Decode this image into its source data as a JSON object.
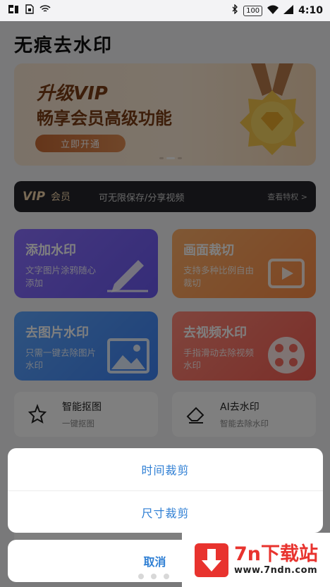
{
  "status_bar": {
    "time": "4:10",
    "battery": "100",
    "icons": [
      "baidu-paw-icon",
      "sim-icon",
      "wifi-icon",
      "bluetooth-icon",
      "battery-icon",
      "wifi-icon",
      "signal-icon"
    ]
  },
  "app": {
    "title": "无痕去水印"
  },
  "banner": {
    "line1": "升级VIP",
    "line2": "畅享会员高级功能",
    "button": "立即开通",
    "slide_count": 3,
    "active_slide": 1
  },
  "vip_bar": {
    "logo": "VIP",
    "member": "会员",
    "desc": "可无限保存/分享视频",
    "link": "查看特权 >"
  },
  "features": [
    {
      "title": "添加水印",
      "sub": "文字图片涂鸦随心添加",
      "icon": "pencil-icon",
      "color": "#7b64f7"
    },
    {
      "title": "画面裁切",
      "sub": "支持多种比例自由裁切",
      "icon": "video-crop-icon",
      "color": "#ff9c55"
    },
    {
      "title": "去图片水印",
      "sub": "只需一键去除图片水印",
      "icon": "image-icon",
      "color": "#4b90f8"
    },
    {
      "title": "去视频水印",
      "sub": "手指滑动去除视频水印",
      "icon": "film-reel-icon",
      "color": "#f96f62"
    }
  ],
  "tools": [
    {
      "title": "智能抠图",
      "sub": "一键抠图",
      "icon": "cutout-icon"
    },
    {
      "title": "AI去水印",
      "sub": "智能去除水印",
      "icon": "eraser-icon"
    }
  ],
  "action_sheet": {
    "items": [
      "时间裁剪",
      "尺寸裁剪"
    ],
    "cancel": "取消"
  },
  "watermark": {
    "brand": "7n下载站",
    "url": "www.7ndn.com"
  }
}
